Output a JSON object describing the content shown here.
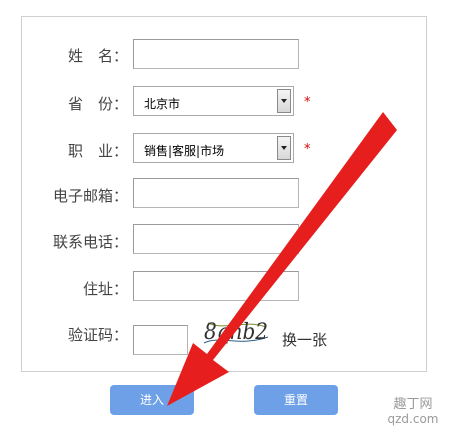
{
  "form": {
    "fields": [
      {
        "label": "姓　名：",
        "type": "text",
        "value": ""
      },
      {
        "label": "省　份：",
        "type": "select",
        "value": "北京市",
        "required": "*"
      },
      {
        "label": "职　业：",
        "type": "select",
        "value": "销售|客服|市场",
        "required": "*"
      },
      {
        "label": "电子邮箱：",
        "type": "text",
        "value": ""
      },
      {
        "label": "联系电话：",
        "type": "text",
        "value": ""
      },
      {
        "label": "住址：",
        "type": "text",
        "value": ""
      },
      {
        "label": "验证码：",
        "type": "text",
        "value": ""
      }
    ],
    "captcha": {
      "code": "8qnb2",
      "change_label": "换一张"
    }
  },
  "buttons": {
    "enter_label": "进入",
    "reset_label": "重置"
  },
  "colors": {
    "button": "#6ea0e8",
    "arrow": "#e61e1e",
    "required": "#e00000"
  },
  "watermark": {
    "text": "趣丁网",
    "domain": "qzd.com"
  }
}
